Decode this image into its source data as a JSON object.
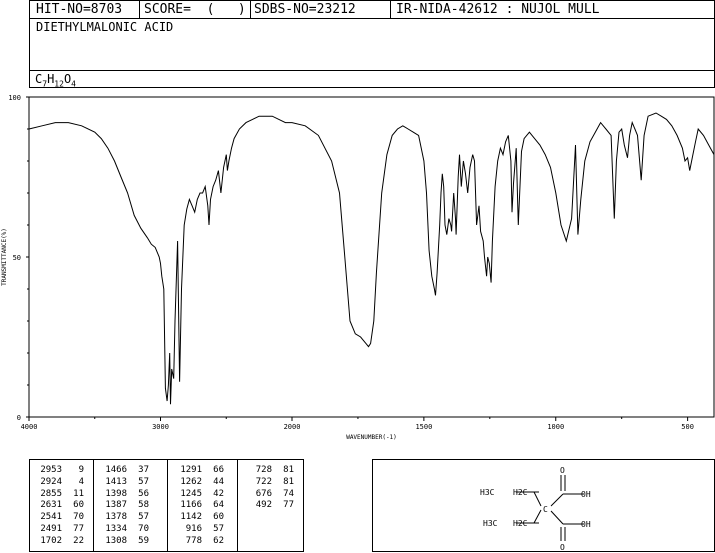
{
  "header": {
    "hit_no": "HIT-NO=8703",
    "score": "SCORE=  (   )",
    "sdbs_no": "SDBS-NO=23212",
    "ir_nida": "IR-NIDA-42612 : NUJOL MULL"
  },
  "compound": {
    "name": "DIETHYLMALONIC ACID",
    "formula": {
      "c": "C",
      "c_n": "7",
      "h": "H",
      "h_n": "12",
      "o": "O",
      "o_n": "4"
    }
  },
  "chart_data": {
    "type": "line",
    "title": "",
    "xlabel": "WAVENUMBER(-1)",
    "ylabel": "TRANSMITTANCE(%)",
    "xlim": [
      4000,
      400
    ],
    "ylim": [
      0,
      100
    ],
    "xticks": [
      "4000",
      "3000",
      "2000",
      "1500",
      "1000",
      "500"
    ],
    "yticks": [
      "100",
      "50",
      "0"
    ],
    "series": [
      {
        "x": [
          4000,
          3900,
          3800,
          3700,
          3600,
          3500,
          3450,
          3400,
          3350,
          3300,
          3250,
          3200,
          3150,
          3100,
          3070,
          3040,
          3010,
          3000,
          2990,
          2975,
          2963,
          2950,
          2940,
          2930,
          2924,
          2915,
          2900,
          2890,
          2870,
          2855,
          2840,
          2820,
          2800,
          2780,
          2760,
          2740,
          2720,
          2700,
          2680,
          2660,
          2640,
          2631,
          2620,
          2600,
          2580,
          2560,
          2541,
          2520,
          2500,
          2491,
          2480,
          2460,
          2440,
          2400,
          2350,
          2300,
          2250,
          2200,
          2150,
          2100,
          2050,
          2000,
          1950,
          1900,
          1850,
          1820,
          1800,
          1780,
          1760,
          1740,
          1730,
          1720,
          1710,
          1702,
          1690,
          1680,
          1660,
          1640,
          1620,
          1600,
          1580,
          1560,
          1540,
          1520,
          1500,
          1490,
          1480,
          1470,
          1460,
          1456,
          1450,
          1440,
          1435,
          1430,
          1425,
          1420,
          1413,
          1405,
          1398,
          1395,
          1387,
          1380,
          1378,
          1370,
          1365,
          1358,
          1350,
          1342,
          1334,
          1325,
          1315,
          1308,
          1300,
          1291,
          1285,
          1275,
          1270,
          1262,
          1258,
          1252,
          1245,
          1240,
          1230,
          1220,
          1210,
          1200,
          1190,
          1180,
          1170,
          1166,
          1160,
          1150,
          1142,
          1130,
          1120,
          1100,
          1080,
          1060,
          1040,
          1020,
          1000,
          980,
          960,
          940,
          925,
          916,
          905,
          890,
          870,
          850,
          830,
          810,
          790,
          778,
          770,
          760,
          750,
          740,
          728,
          720,
          710,
          700,
          690,
          676,
          665,
          650,
          620,
          600,
          580,
          560,
          540,
          520,
          510,
          500,
          492,
          480,
          470,
          460,
          440,
          420,
          400
        ],
        "y": [
          90,
          91,
          92,
          92,
          91,
          89,
          87,
          84,
          80,
          75,
          70,
          63,
          59,
          56,
          54,
          53,
          50,
          48,
          44,
          40,
          9,
          5,
          10,
          20,
          4,
          15,
          12,
          30,
          55,
          11,
          40,
          60,
          65,
          68,
          66,
          64,
          68,
          70,
          70,
          72,
          66,
          60,
          68,
          72,
          74,
          77,
          70,
          78,
          82,
          77,
          80,
          84,
          87,
          90,
          92,
          93,
          94,
          94,
          94,
          93,
          92,
          92,
          91,
          88,
          80,
          70,
          50,
          30,
          26,
          25,
          24,
          23,
          22,
          23,
          30,
          45,
          70,
          82,
          88,
          90,
          91,
          90,
          89,
          88,
          80,
          70,
          52,
          44,
          40,
          38,
          45,
          60,
          70,
          76,
          72,
          60,
          57,
          62,
          60,
          58,
          70,
          62,
          57,
          75,
          82,
          72,
          80,
          76,
          70,
          78,
          82,
          80,
          60,
          66,
          58,
          55,
          50,
          44,
          50,
          48,
          42,
          55,
          72,
          80,
          84,
          82,
          86,
          88,
          80,
          64,
          73,
          84,
          60,
          83,
          87,
          89,
          87,
          85,
          82,
          78,
          70,
          60,
          55,
          62,
          85,
          57,
          68,
          80,
          86,
          89,
          92,
          90,
          88,
          62,
          80,
          89,
          90,
          85,
          81,
          88,
          92,
          90,
          88,
          74,
          88,
          94,
          95,
          94,
          93,
          91,
          88,
          84,
          80,
          81,
          77,
          82,
          86,
          90,
          88,
          85,
          82
        ]
      }
    ],
    "peaks": [
      [
        "2953",
        "9"
      ],
      [
        "2924",
        "4"
      ],
      [
        "2855",
        "11"
      ],
      [
        "2631",
        "60"
      ],
      [
        "2541",
        "70"
      ],
      [
        "2491",
        "77"
      ],
      [
        "1702",
        "22"
      ],
      [
        "1466",
        "37"
      ],
      [
        "1413",
        "57"
      ],
      [
        "1398",
        "56"
      ],
      [
        "1387",
        "58"
      ],
      [
        "1378",
        "57"
      ],
      [
        "1334",
        "70"
      ],
      [
        "1308",
        "59"
      ],
      [
        "1291",
        "66"
      ],
      [
        "1262",
        "44"
      ],
      [
        "1245",
        "42"
      ],
      [
        "1166",
        "64"
      ],
      [
        "1142",
        "60"
      ],
      [
        "916",
        "57"
      ],
      [
        "778",
        "62"
      ],
      [
        "728",
        "81"
      ],
      [
        "722",
        "81"
      ],
      [
        "676",
        "74"
      ],
      [
        "492",
        "77"
      ]
    ]
  },
  "structure": {
    "h3c_top": "H3C",
    "h2c_top": "H2C",
    "c_center": "C",
    "h3c_bot": "H3C",
    "h2c_bot": "H2C",
    "o_top": "O",
    "oh_top": "OH",
    "o_bot": "O",
    "oh_bot": "OH"
  }
}
